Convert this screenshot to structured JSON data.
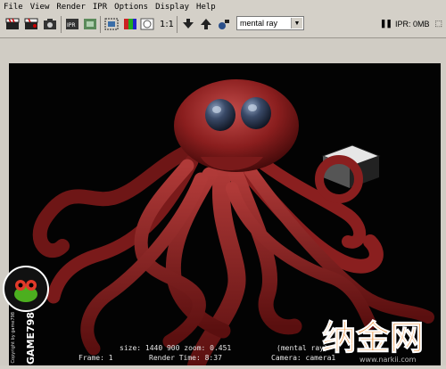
{
  "menu": [
    "File",
    "View",
    "Render",
    "IPR",
    "Options",
    "Display",
    "Help"
  ],
  "toolbar": {
    "ratio_label": "1:1",
    "renderer": "mental ray",
    "ipr_label": "IPR: 0MB",
    "ipr_tag": "⬚"
  },
  "render": {
    "size_text": "size: 1440  900 zoom: 0.451",
    "frame_text": "Frame: 1",
    "render_time_text": "Render Time:  8:37",
    "renderer_text": "(mental ray)",
    "camera_text": "Camera: camera1"
  },
  "watermark": {
    "brand": "GAME798",
    "copyright": "Copyright by game798",
    "site_logo": "纳金网",
    "site_url": "www.narkii.com"
  },
  "icons": [
    "render-clapper-icon",
    "render-redo-icon",
    "snapshot-camera-icon",
    "ipr-icon",
    "ipr-refresh-icon",
    "render-region-icon",
    "color-channel-icon",
    "alpha-channel-icon",
    "keep-image-icon",
    "remove-image-icon",
    "camera-attribute-icon"
  ],
  "colors": {
    "octopus": "#8a1e1e",
    "octopus_highlight": "#c04a48",
    "background": "#030303",
    "chrome": "#d4d0c8"
  }
}
